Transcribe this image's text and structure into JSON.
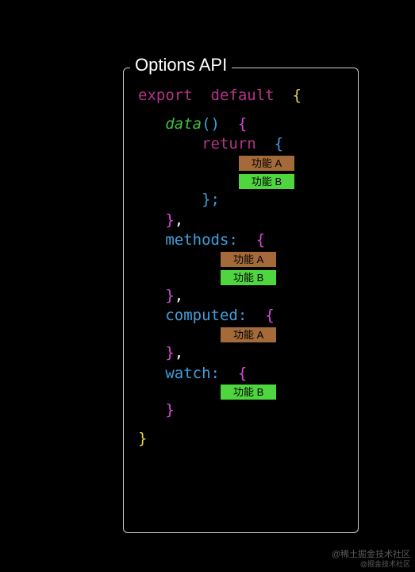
{
  "panel": {
    "title": "Options API"
  },
  "code": {
    "export_kw": "export",
    "default_kw": "default",
    "data_fn": "data",
    "return_kw": "return",
    "methods_prop": "methods",
    "computed_prop": "computed",
    "watch_prop": "watch"
  },
  "boxes": {
    "feature_a": "功能 A",
    "feature_b": "功能 B"
  },
  "watermark": {
    "line1": "@稀土掘金技术社区",
    "line2": "@掘金技术社区"
  }
}
